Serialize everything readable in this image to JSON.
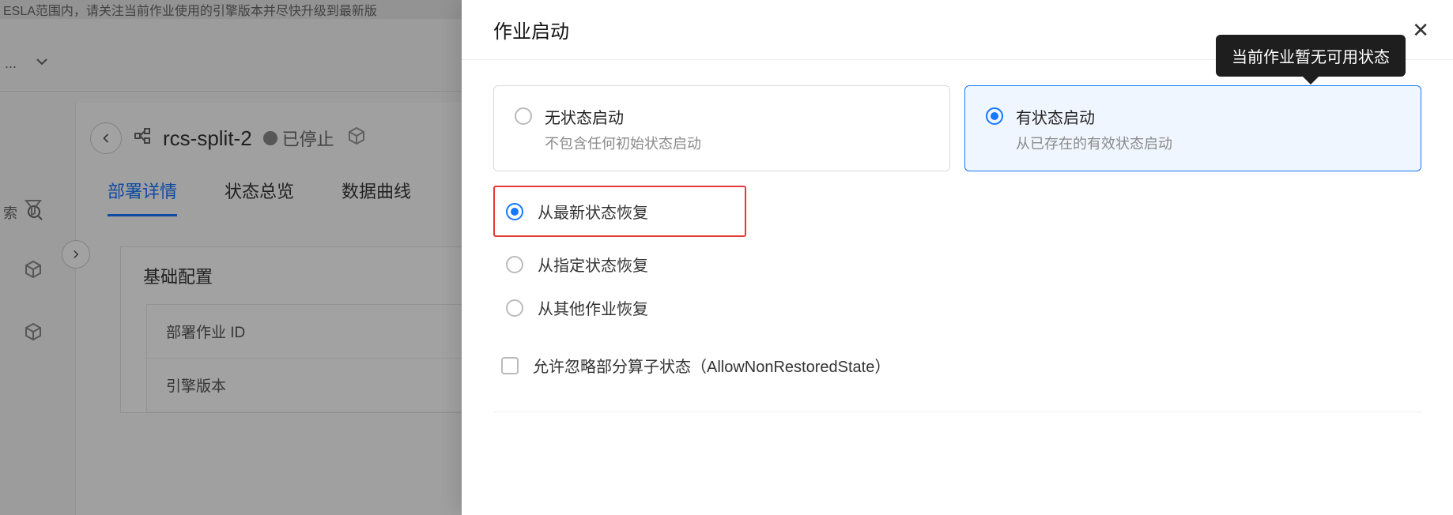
{
  "bg": {
    "topbar_fragment": "ESLA范围内，请关注当前作业使用的引擎版本并尽快升级到最新版",
    "breadcrumb_trail": "...",
    "search_fragment": "索",
    "job_name": "rcs-split-2",
    "status_label": "已停止",
    "tabs": [
      "部署详情",
      "状态总览",
      "数据曲线"
    ],
    "active_tab_index": 0,
    "panel_title": "基础配置",
    "panel_rows": [
      "部署作业 ID",
      "引擎版本"
    ]
  },
  "drawer": {
    "title": "作业启动",
    "cards": [
      {
        "title": "无状态启动",
        "sub": "不包含任何初始状态启动"
      },
      {
        "title": "有状态启动",
        "sub": "从已存在的有效状态启动"
      }
    ],
    "active_card_index": 1,
    "recover_options": [
      "从最新状态恢复",
      "从指定状态恢复",
      "从其他作业恢复"
    ],
    "selected_recover_index": 0,
    "allow_non_restored_label": "允许忽略部分算子状态（AllowNonRestoredState）",
    "tooltip": "当前作业暂无可用状态"
  }
}
